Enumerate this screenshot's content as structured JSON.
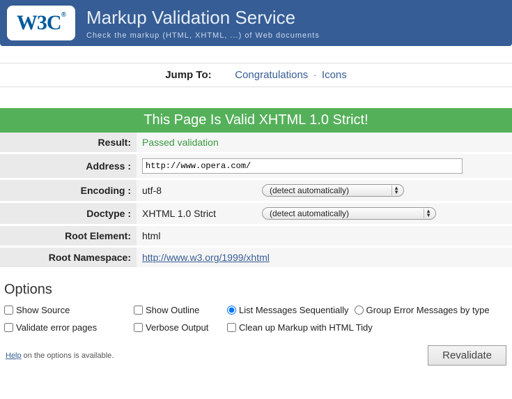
{
  "header": {
    "logo": "W3C",
    "logo_reg": "®",
    "title": "Markup Validation Service",
    "subtitle": "Check the markup (HTML, XHTML, ...) of Web documents"
  },
  "jumpto": {
    "label": "Jump To:",
    "link1": "Congratulations",
    "sep": "·",
    "link2": "Icons"
  },
  "banner": "This Page Is Valid XHTML 1.0 Strict!",
  "results": {
    "result_label": "Result:",
    "result_value": "Passed validation",
    "address_label": "Address :",
    "address_value": "http://www.opera.com/",
    "encoding_label": "Encoding :",
    "encoding_value": "utf-8",
    "encoding_select": "(detect automatically)",
    "doctype_label": "Doctype :",
    "doctype_value": "XHTML 1.0 Strict",
    "doctype_select": "(detect automatically)",
    "root_elem_label": "Root Element:",
    "root_elem_value": "html",
    "root_ns_label": "Root Namespace:",
    "root_ns_value": "http://www.w3.org/1999/xhtml"
  },
  "options": {
    "title": "Options",
    "show_source": "Show Source",
    "show_outline": "Show Outline",
    "list_seq": "List Messages Sequentially",
    "group_err": "Group Error Messages by type",
    "validate_err": "Validate error pages",
    "verbose": "Verbose Output",
    "cleanup": "Clean up Markup with HTML Tidy",
    "help_link": "Help",
    "help_rest": " on the options is available.",
    "revalidate": "Revalidate"
  }
}
